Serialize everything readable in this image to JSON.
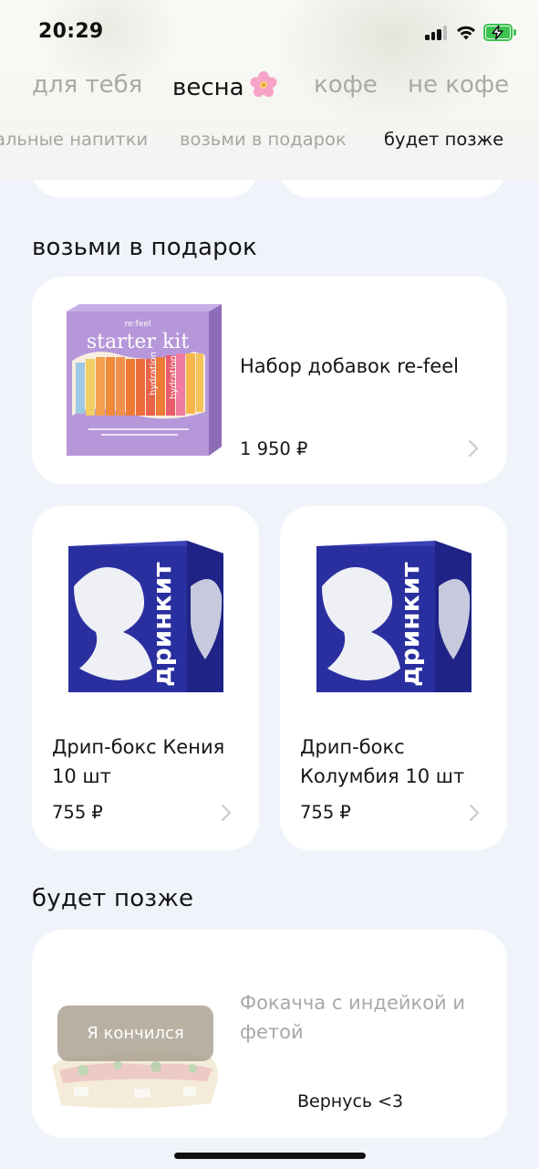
{
  "status": {
    "time": "20:29"
  },
  "tabs": [
    "для тебя",
    "весна",
    "кофе",
    "не кофе"
  ],
  "active_tab": "весна",
  "subtabs": [
    "альные напитки",
    "возьми в подарок",
    "будет позже"
  ],
  "sections": {
    "gift": {
      "title": "возьми в подарок",
      "kit": {
        "name": "Набор добавок re-feel",
        "price": "1 950 ₽",
        "box_brand": "re:feel",
        "box_title": "starter kit",
        "stick_label": "hydration"
      },
      "drip_kenya": {
        "name_line1": "Дрип-бокс Кения",
        "name_line2": "10 шт",
        "price": "755 ₽",
        "box_brand": "дринкит"
      },
      "drip_colombia": {
        "name_line1": "Дрип-бокс",
        "name_line2": "Колумбия 10 шт",
        "price": "755 ₽",
        "box_brand": "дринкит"
      }
    },
    "later": {
      "title": "будет позже",
      "focaccia": {
        "name_line1": "Фокачча с индейкой и",
        "name_line2": "фетой",
        "badge": "Я кончился",
        "return_note": "Вернусь <3"
      }
    }
  },
  "colors": {
    "background": "#f0f4fa",
    "card": "#ffffff",
    "box_blue": "#2a2fa0",
    "kit_purple": "#b494d6",
    "battery_green": "#3cc452",
    "muted_text": "#a9aaa6"
  },
  "icons": [
    "signal-icon",
    "wifi-icon",
    "battery-charging-icon",
    "cherry-blossom-icon",
    "chevron-right-icon"
  ]
}
